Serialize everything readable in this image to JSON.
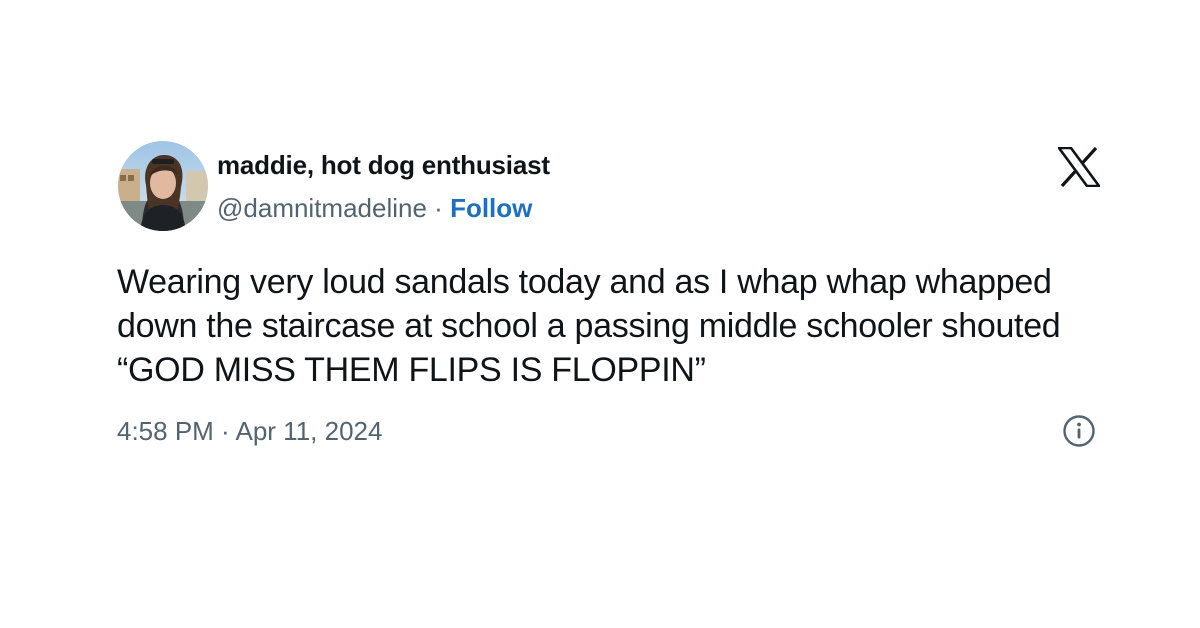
{
  "author": {
    "display_name": "maddie, hot dog enthusiast",
    "handle": "@damnitmadeline",
    "separator": " · ",
    "follow_label": "Follow",
    "avatar_icon": "profile-photo"
  },
  "post": {
    "text": "Wearing very loud sandals today and as I whap whap whapped down the staircase at school a passing middle schooler shouted “GOD MISS THEM FLIPS IS FLOPPIN”",
    "timestamp": "4:58 PM · Apr 11, 2024"
  },
  "icons": {
    "brand": "x-logo-icon",
    "info": "info-icon"
  },
  "colors": {
    "text": "#0f1419",
    "muted": "#536471",
    "link": "#1d6fc2",
    "background": "#ffffff"
  }
}
